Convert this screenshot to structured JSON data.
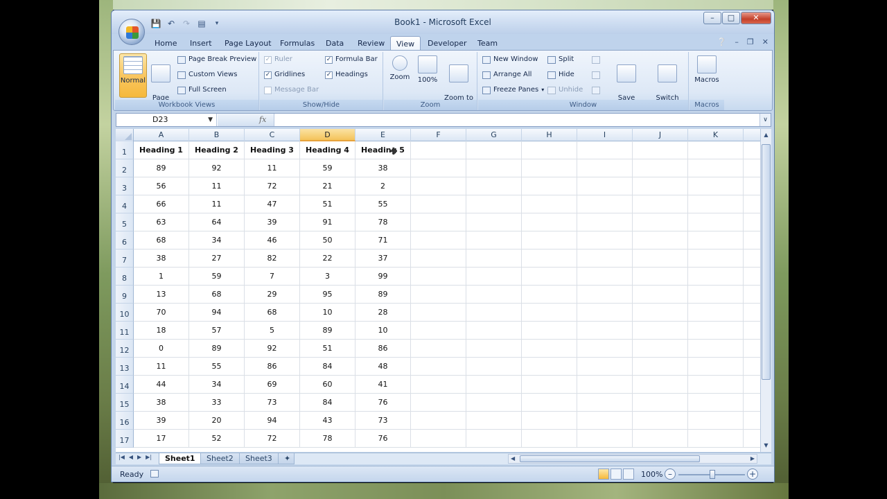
{
  "window": {
    "title": "Book1 - Microsoft Excel"
  },
  "qat": {
    "icons": [
      "save-icon",
      "undo-icon",
      "redo-icon",
      "print-preview-icon",
      "customize-icon"
    ]
  },
  "tabs": [
    "Home",
    "Insert",
    "Page Layout",
    "Formulas",
    "Data",
    "Review",
    "View",
    "Developer",
    "Team"
  ],
  "active_tab": "View",
  "ribbon": {
    "workbook_views": {
      "label": "Workbook Views",
      "normal": "Normal",
      "page_layout": "Page\nLayout",
      "page_break_preview": "Page Break Preview",
      "custom_views": "Custom Views",
      "full_screen": "Full Screen"
    },
    "show_hide": {
      "label": "Show/Hide",
      "ruler": "Ruler",
      "gridlines": "Gridlines",
      "message_bar": "Message Bar",
      "formula_bar": "Formula Bar",
      "headings": "Headings"
    },
    "zoom": {
      "label": "Zoom",
      "zoom": "Zoom",
      "hundred": "100%",
      "zoom_to_selection": "Zoom to\nSelection"
    },
    "window": {
      "label": "Window",
      "new_window": "New Window",
      "arrange_all": "Arrange All",
      "freeze_panes": "Freeze Panes",
      "split": "Split",
      "hide": "Hide",
      "unhide": "Unhide",
      "save_workspace": "Save\nWorkspace",
      "switch_windows": "Switch\nWindows"
    },
    "macros": {
      "label": "Macros",
      "macros": "Macros"
    }
  },
  "formula_bar": {
    "name_box": "D23",
    "fx": "fx",
    "value": ""
  },
  "grid": {
    "columns": [
      "A",
      "B",
      "C",
      "D",
      "E",
      "F",
      "G",
      "H",
      "I",
      "J",
      "K"
    ],
    "selected_column": "D",
    "rows": [
      {
        "n": "1",
        "cells": [
          "Heading 1",
          "Heading 2",
          "Heading 3",
          "Heading 4",
          "Heading 5"
        ]
      },
      {
        "n": "2",
        "cells": [
          "89",
          "92",
          "11",
          "59",
          "38"
        ]
      },
      {
        "n": "3",
        "cells": [
          "56",
          "11",
          "72",
          "21",
          "2"
        ]
      },
      {
        "n": "4",
        "cells": [
          "66",
          "11",
          "47",
          "51",
          "55"
        ]
      },
      {
        "n": "5",
        "cells": [
          "63",
          "64",
          "39",
          "91",
          "78"
        ]
      },
      {
        "n": "6",
        "cells": [
          "68",
          "34",
          "46",
          "50",
          "71"
        ]
      },
      {
        "n": "7",
        "cells": [
          "38",
          "27",
          "82",
          "22",
          "37"
        ]
      },
      {
        "n": "8",
        "cells": [
          "1",
          "59",
          "7",
          "3",
          "99"
        ]
      },
      {
        "n": "9",
        "cells": [
          "13",
          "68",
          "29",
          "95",
          "89"
        ]
      },
      {
        "n": "10",
        "cells": [
          "70",
          "94",
          "68",
          "10",
          "28"
        ]
      },
      {
        "n": "11",
        "cells": [
          "18",
          "57",
          "5",
          "89",
          "10"
        ]
      },
      {
        "n": "12",
        "cells": [
          "0",
          "89",
          "92",
          "51",
          "86"
        ]
      },
      {
        "n": "13",
        "cells": [
          "11",
          "55",
          "86",
          "84",
          "48"
        ]
      },
      {
        "n": "14",
        "cells": [
          "44",
          "34",
          "69",
          "60",
          "41"
        ]
      },
      {
        "n": "15",
        "cells": [
          "38",
          "33",
          "73",
          "84",
          "76"
        ]
      },
      {
        "n": "16",
        "cells": [
          "39",
          "20",
          "94",
          "43",
          "73"
        ]
      },
      {
        "n": "17",
        "cells": [
          "17",
          "52",
          "72",
          "78",
          "76"
        ]
      }
    ]
  },
  "sheets": [
    "Sheet1",
    "Sheet2",
    "Sheet3"
  ],
  "active_sheet": "Sheet1",
  "status": {
    "text": "Ready",
    "zoom": "100%"
  }
}
